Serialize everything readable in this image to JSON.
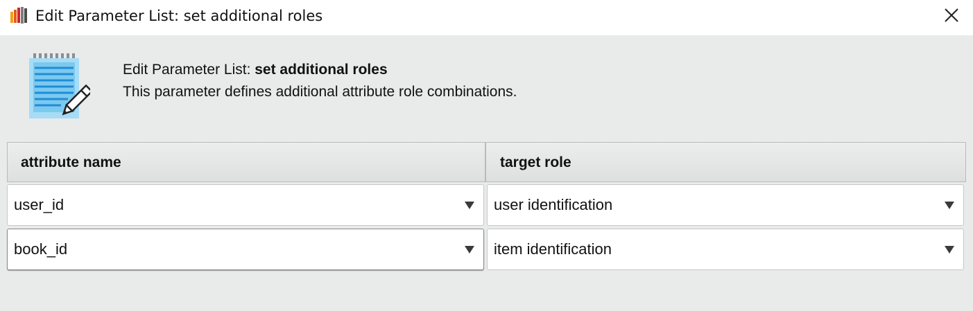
{
  "window": {
    "title": "Edit Parameter List: set additional roles",
    "app_icon": "rapidminer-logo-icon",
    "close_icon": "close-icon"
  },
  "header": {
    "icon": "notepad-pencil-icon",
    "title_prefix": "Edit Parameter List: ",
    "title_bold": "set additional roles",
    "description": "This parameter defines additional attribute role combinations."
  },
  "table": {
    "columns": [
      "attribute name",
      "target role"
    ],
    "rows": [
      {
        "attribute": "user_id",
        "role": "user identification"
      },
      {
        "attribute": "book_id",
        "role": "item identification"
      }
    ],
    "dropdown_icon": "dropdown-arrow-icon"
  },
  "colors": {
    "background": "#e9eaea",
    "titlebar": "#ffffff",
    "icon_blue": "#2a9fde"
  }
}
